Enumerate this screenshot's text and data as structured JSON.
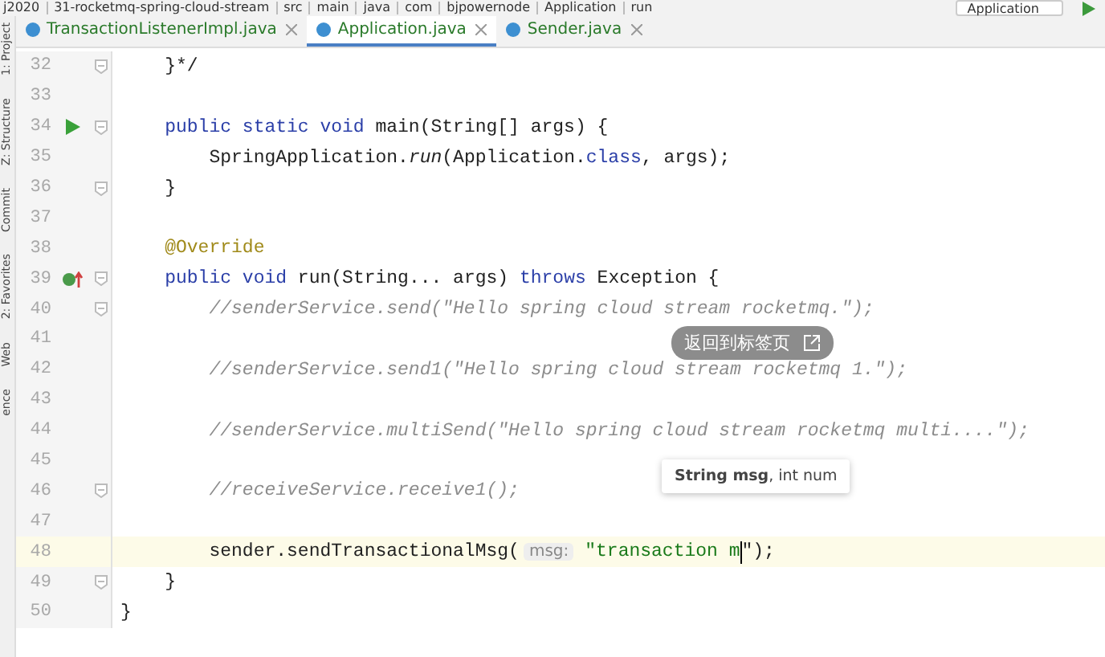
{
  "breadcrumb": [
    "j2020",
    "31-rocketmq-spring-cloud-stream",
    "src",
    "main",
    "java",
    "com",
    "bjpowernode",
    "Application",
    "run"
  ],
  "run_config": {
    "label": "Application"
  },
  "tool_strip": [
    "1: Project",
    "Z: Structure",
    "Commit",
    "2: Favorites",
    "Web",
    "ence"
  ],
  "tabs": [
    {
      "label": "TransactionListenerImpl.java",
      "selected": false
    },
    {
      "label": "Application.java",
      "selected": true
    },
    {
      "label": "Sender.java",
      "selected": false
    }
  ],
  "lines": [
    {
      "number": "32",
      "current": false,
      "fold": true,
      "tokens": [
        {
          "t": "    }*/",
          "kind": "plain"
        }
      ]
    },
    {
      "number": "33",
      "current": false,
      "fold": false
    },
    {
      "number": "34",
      "current": false,
      "fold": true,
      "gutter_icon": {
        "kind": "run"
      },
      "tokens": [
        {
          "t": "    public static void",
          "kind": "kw"
        },
        {
          "t": " main(String[] args) {",
          "kind": "plain"
        }
      ]
    },
    {
      "number": "35",
      "current": false,
      "fold": false,
      "tokens": [
        {
          "t": "        SpringApplication.",
          "kind": "plain"
        },
        {
          "t": "run",
          "kind": "static"
        },
        {
          "t": "(Application.",
          "kind": "plain"
        },
        {
          "t": "class",
          "kind": "kw"
        },
        {
          "t": ", args);",
          "kind": "plain"
        }
      ]
    },
    {
      "number": "36",
      "current": false,
      "fold": true,
      "tokens": [
        {
          "t": "    }",
          "kind": "plain"
        }
      ]
    },
    {
      "number": "37",
      "current": false,
      "fold": false
    },
    {
      "number": "38",
      "current": false,
      "fold": false,
      "tokens": [
        {
          "t": "    @Override",
          "kind": "annot"
        }
      ]
    },
    {
      "number": "39",
      "current": false,
      "fold": true,
      "gutter_icon": {
        "kind": "override"
      },
      "tokens": [
        {
          "t": "    public void",
          "kind": "kw"
        },
        {
          "t": " run(String... args) ",
          "kind": "plain"
        },
        {
          "t": "throws",
          "kind": "kw"
        },
        {
          "t": " Exception {",
          "kind": "plain"
        }
      ]
    },
    {
      "number": "40",
      "current": false,
      "fold": true,
      "tokens": [
        {
          "t": "        //senderService.send(\"Hello spring cloud stream rocketmq.\");",
          "kind": "comment"
        }
      ]
    },
    {
      "number": "41",
      "current": false,
      "fold": false
    },
    {
      "number": "42",
      "current": false,
      "fold": false,
      "tokens": [
        {
          "t": "        //senderService.send1(\"Hello spring cloud stream rocketmq 1.\");",
          "kind": "comment"
        }
      ]
    },
    {
      "number": "43",
      "current": false,
      "fold": false
    },
    {
      "number": "44",
      "current": false,
      "fold": false,
      "tokens": [
        {
          "t": "        //senderService.multiSend(\"Hello spring cloud stream rocketmq multi....\");",
          "kind": "comment"
        }
      ]
    },
    {
      "number": "45",
      "current": false,
      "fold": false
    },
    {
      "number": "46",
      "current": false,
      "fold": true,
      "tokens": [
        {
          "t": "        //receiveService.receive1();",
          "kind": "comment"
        }
      ]
    },
    {
      "number": "47",
      "current": false,
      "fold": false
    },
    {
      "number": "48",
      "current": true,
      "fold": false,
      "tokens": [
        {
          "t": "        sender.sendTransactionalMsg(",
          "kind": "plain"
        },
        {
          "t": "msg:",
          "kind": "hint"
        },
        {
          "t": "\"transaction m",
          "kind": "str",
          "caret": true
        },
        {
          "t": "\");",
          "kind": "plain"
        }
      ]
    },
    {
      "number": "49",
      "current": false,
      "fold": true,
      "tokens": [
        {
          "t": "    }",
          "kind": "plain"
        }
      ]
    },
    {
      "number": "50",
      "current": false,
      "fold": false,
      "tokens": [
        {
          "t": "}",
          "kind": "plain"
        }
      ]
    }
  ],
  "param_tooltip": {
    "text": "**String msg**, int num"
  },
  "overlay_button": {
    "label": "返回到标签页"
  }
}
